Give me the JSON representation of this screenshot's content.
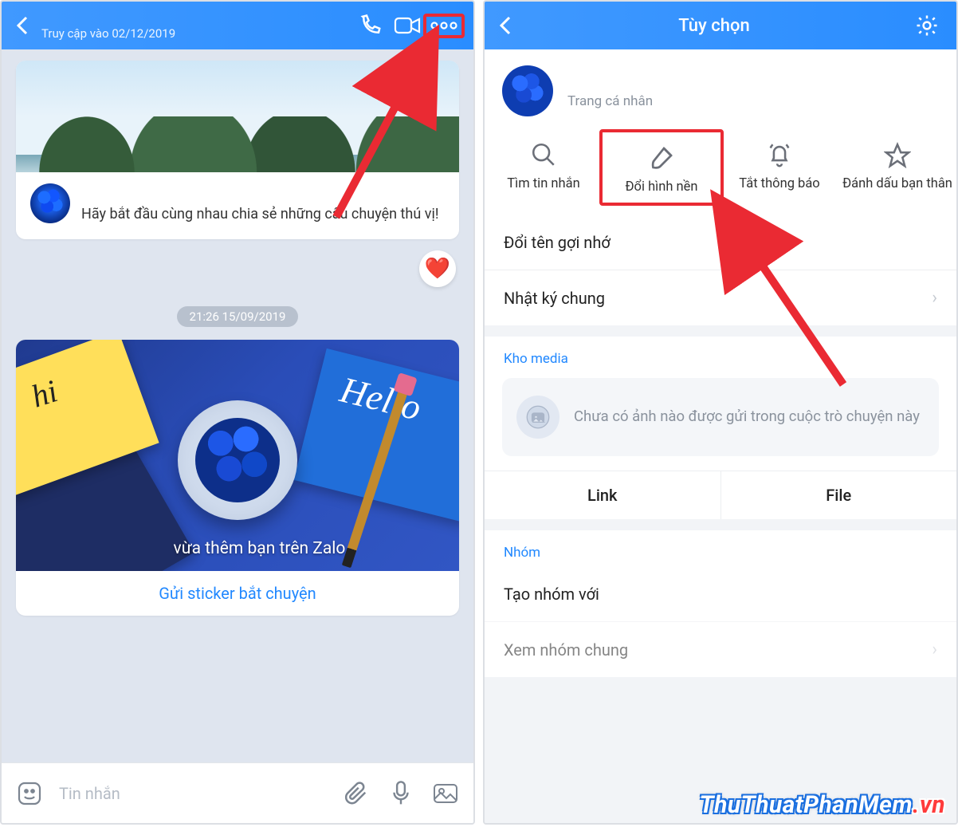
{
  "left": {
    "header": {
      "last_seen": "Truy cập vào 02/12/2019"
    },
    "card1": {
      "message": "Hãy bắt đầu cùng nhau chia sẻ những câu chuyện thú vị!"
    },
    "reaction_emoji": "❤️",
    "timestamp_pill": "21:26 15/09/2019",
    "card2": {
      "hello_text": "Hello",
      "hi_text": "hi",
      "caption_suffix": "vừa thêm bạn trên Zalo",
      "button": "Gửi sticker bắt chuyện"
    },
    "composer": {
      "placeholder": "Tin nhắn"
    }
  },
  "right": {
    "header_title": "Tùy chọn",
    "profile_link": "Trang cá nhân",
    "actions": {
      "search": "Tìm tin nhắn",
      "background": "Đổi hình nền",
      "mute": "Tắt thông báo",
      "bestfriend": "Đánh dấu bạn thân"
    },
    "rename": "Đổi tên gợi nhớ",
    "shared_diary": "Nhật ký chung",
    "media_section": "Kho media",
    "media_empty": "Chưa có ảnh nào được gửi trong cuộc trò chuyện này",
    "tab_link": "Link",
    "tab_file": "File",
    "group_section": "Nhóm",
    "create_group_prefix": "Tạo nhóm với",
    "view_common_groups": "Xem nhóm chung"
  },
  "watermark": {
    "main": "ThuThuatPhanMem",
    "suffix": ".vn"
  }
}
